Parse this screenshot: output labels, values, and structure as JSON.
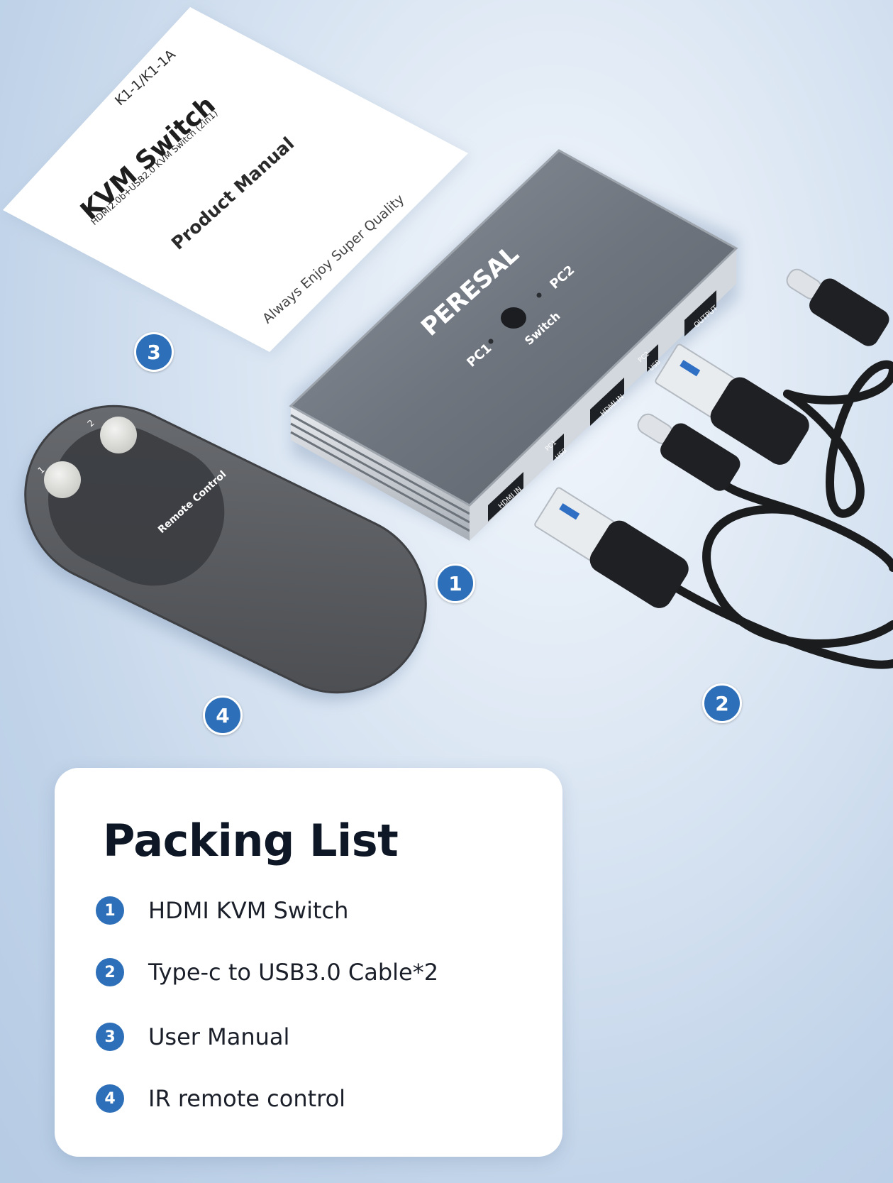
{
  "manual": {
    "model": "K1-1/K1-1A",
    "title": "KVM Switch",
    "subtitle": "HDMI2.0b+USB2.0 KVM Switch (2in1)",
    "doc_type": "Product Manual",
    "tagline": "Always Enjoy Super Quality"
  },
  "device": {
    "brand": "PERESAL",
    "label_pc1": "PC1",
    "label_pc2": "PC2",
    "label_switch": "Switch",
    "port_hdmi_in_1": "HDMI IN",
    "port_hdmi_in_2": "HDMI IN",
    "port_output": "OUTPUT",
    "port_usb_1": "USB",
    "port_usb_2": "USB",
    "port_pc1": "PC1",
    "port_pc2": "PC2"
  },
  "remote": {
    "label": "Remote Control",
    "button1": "1",
    "button2": "2"
  },
  "badges": {
    "b1": "1",
    "b2": "2",
    "b3": "3",
    "b4": "4"
  },
  "colors": {
    "accent": "#2d6fb8",
    "title": "#0e1726"
  },
  "packing_list": {
    "title": "Packing List",
    "items": [
      {
        "num": "1",
        "label": "HDMI KVM Switch"
      },
      {
        "num": "2",
        "label": "Type-c to USB3.0 Cable*2"
      },
      {
        "num": "3",
        "label": "User Manual"
      },
      {
        "num": "4",
        "label": "IR remote control"
      }
    ]
  }
}
